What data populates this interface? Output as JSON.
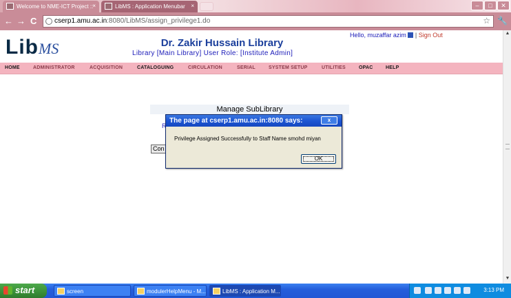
{
  "browser": {
    "tabs": [
      {
        "label": "Welcome to NME-ICT Project :: ",
        "close": "×"
      },
      {
        "label": "LibMS : Application Menubar",
        "close": "×"
      }
    ],
    "window_buttons": {
      "minimize": "–",
      "maximize": "□",
      "close": "✕"
    },
    "nav": {
      "back": "←",
      "forward": "→",
      "reload": "C"
    },
    "url_domain": "cserp1.amu.ac.in",
    "url_path": ":8080/LibMS/assign_privilege1.do",
    "bookmark": "☆",
    "wrench": "🔧"
  },
  "header": {
    "logo_lib": "Lib",
    "logo_ms": "MS",
    "title": "Dr. Zakir Hussain Library",
    "role_line": "Library [Main Library]  User Role: [Institute Admin]",
    "hello": "Hello,  muzaffar azim",
    "separator": " | ",
    "sign_out": "Sign Out"
  },
  "menu": [
    "HOME",
    "ADMINISTRATOR",
    "ACQUISITION",
    "CATALOGUING",
    "CIRCULATION",
    "SERIAL",
    "SYSTEM SETUP",
    "UTILITIES",
    "OPAC",
    "HELP"
  ],
  "sublibrary": {
    "heading": "Manage SubLibrary",
    "peek_text": "R",
    "peek_button": "Con"
  },
  "dialog": {
    "title": "The page at cserp1.amu.ac.in:8080 says:",
    "close": "x",
    "message": "Privilege Assigned Successfully to Staff Name smohd miyan",
    "ok": "OK"
  },
  "taskbar": {
    "start": "start",
    "items": [
      {
        "label": "screen"
      },
      {
        "label": "modulerHelpMenu - M..."
      },
      {
        "label": "LibMS : Application M..."
      }
    ],
    "clock": "3:13 PM"
  },
  "colors": {
    "menubar_bg": "#f4b4bf",
    "title_blue": "#1b3f9c",
    "dialog_title": "#1d56d3",
    "taskbar": "#245edb"
  }
}
